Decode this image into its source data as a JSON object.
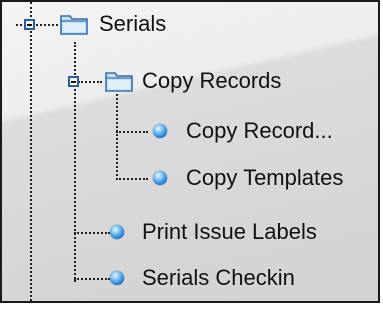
{
  "tree": {
    "serials": {
      "label": "Serials",
      "icon": "folder-icon",
      "expanded": true
    },
    "copy_records": {
      "label": "Copy Records",
      "icon": "folder-icon",
      "expanded": true,
      "children": [
        {
          "label": "Copy Record...",
          "icon": "blue-bullet-icon"
        },
        {
          "label": "Copy Templates",
          "icon": "blue-bullet-icon"
        }
      ]
    },
    "items": [
      {
        "label": "Print Issue Labels",
        "icon": "blue-bullet-icon"
      },
      {
        "label": "Serials Checkin",
        "icon": "blue-bullet-icon"
      }
    ]
  },
  "colors": {
    "accent": "#1f78d1",
    "folder": "#bfe0f5",
    "expander_border": "#2a5ca8"
  }
}
